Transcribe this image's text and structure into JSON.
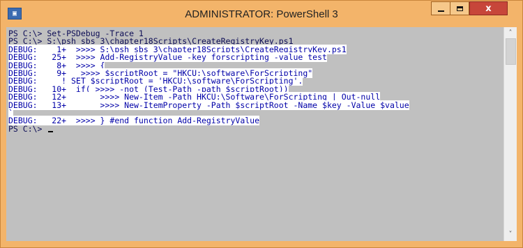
{
  "window": {
    "title": "ADMINISTRATOR: PowerShell 3",
    "icon_glyph": "▣",
    "close_glyph": "x"
  },
  "console": {
    "lines": [
      {
        "text": "PS C:\\> Set-PSDebug -Trace 1",
        "highlight": false
      },
      {
        "text": "PS C:\\> S:\\psh_sbs_3\\chapter18Scripts\\CreateRegistryKey.ps1",
        "highlight": false
      },
      {
        "text": "DEBUG:    1+  >>>> S:\\psh_sbs_3\\chapter18Scripts\\CreateRegistryKey.ps1",
        "highlight": true
      },
      {
        "text": "DEBUG:   25+  >>>> Add-RegistryValue -key forscripting -value test",
        "highlight": true
      },
      {
        "text": "DEBUG:    8+  >>>> {",
        "highlight": true
      },
      {
        "text": "DEBUG:    9+   >>>> $scriptRoot = \"HKCU:\\software\\ForScripting\"",
        "highlight": true
      },
      {
        "text": "DEBUG:     ! SET $scriptRoot = 'HKCU:\\software\\ForScripting'.",
        "highlight": true
      },
      {
        "text": "DEBUG:   10+  if( >>>> -not (Test-Path -path $scriptRoot))",
        "highlight": true
      },
      {
        "text": "DEBUG:   12+       >>>> New-Item -Path HKCU:\\Software\\ForScripting | Out-null",
        "highlight": true
      },
      {
        "text": "DEBUG:   13+       >>>> New-ItemProperty -Path $scriptRoot -Name $key -Value $value",
        "highlight": true
      },
      {
        "text": "`",
        "highlight": true
      },
      {
        "text": "DEBUG:   22+  >>>> } #end function Add-RegistryValue",
        "highlight": true
      },
      {
        "text": "PS C:\\> ",
        "highlight": false,
        "cursor": true
      }
    ]
  },
  "scrollbar": {
    "up_glyph": "˄",
    "down_glyph": "˅"
  },
  "colors": {
    "titlebar": "#f3b46a",
    "console_bg": "#c0c0c0",
    "debug_highlight_bg": "#ffffff",
    "debug_text": "#0000a8",
    "close_button": "#c7463a"
  }
}
